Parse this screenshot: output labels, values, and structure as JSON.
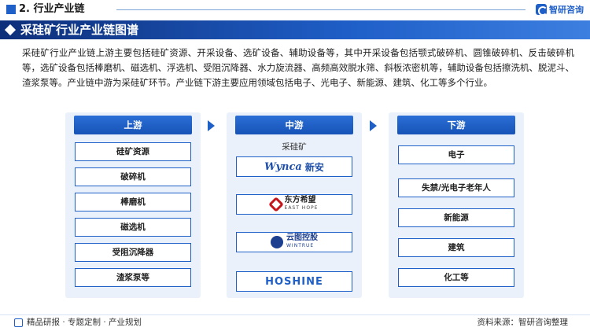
{
  "header": {
    "section_title": "2. 行业产业链",
    "brand": "智研咨询"
  },
  "banner": {
    "title": "采硅矿行业产业链图谱"
  },
  "description": "采硅矿行业产业链上游主要包括硅矿资源、开采设备、选矿设备、辅助设备等，其中开采设备包括颚式破碎机、圆锥破碎机、反击破碎机等，选矿设备包括棒磨机、磁选机、浮选机、受阻沉降器、水力旋流器、高频高效脱水筛、斜板浓密机等，辅助设备包括擦洗机、脱泥斗、渣浆泵等。产业链中游为采硅矿环节。产业链下游主要应用领域包括电子、光电子、新能源、建筑、化工等多个行业。",
  "upstream": {
    "title": "上游",
    "items": [
      "硅矿资源",
      "破碎机",
      "棒磨机",
      "磁选机",
      "受阻沉降器",
      "渣浆泵等"
    ]
  },
  "midstream": {
    "title": "中游",
    "label": "采硅矿",
    "logos": [
      {
        "text": "Wynca",
        "text2": "新安"
      },
      {
        "text": "东方希望",
        "text2": "EAST HOPE"
      },
      {
        "text": "云图控股",
        "text2": "WINTRUE"
      },
      {
        "text": "HOSHINE"
      }
    ]
  },
  "downstream": {
    "title": "下游",
    "items": [
      "电子",
      "失禁/光电子老年人",
      "新能源",
      "建筑",
      "化工等"
    ]
  },
  "footer": {
    "left": "精品研报 · 专题定制 · 产业规划",
    "right": "资料来源：智研咨询整理"
  },
  "colors": {
    "brand_blue": "#1f5fc8",
    "panel_bg": "#eaf1fb",
    "banner_dark": "#0e2f7a"
  }
}
